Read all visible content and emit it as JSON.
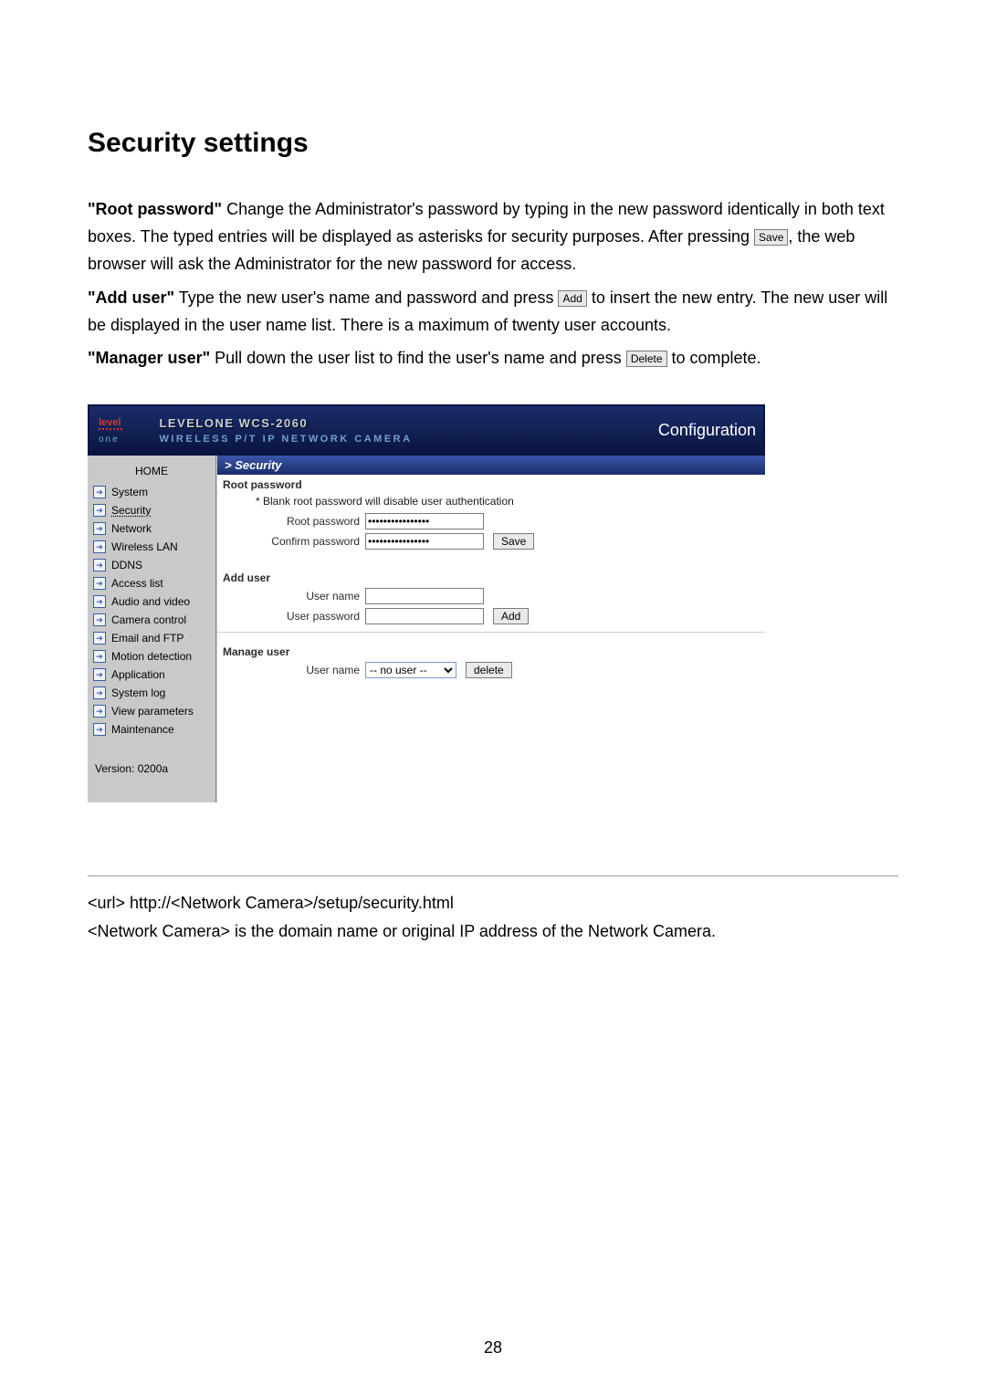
{
  "doc": {
    "title": "Security settings",
    "para1_a": "\"Root password\"",
    "para1_b": " Change the Administrator's password by typing in the new password identically in both text boxes. The typed entries will be displayed as asterisks for security purposes. After pressing ",
    "para1_c": ", the web browser will ask the Administrator for the new password for access.",
    "para2_a": "\"Add user\"",
    "para2_b": " Type the new user's name and password and press ",
    "para2_c": " to insert the new entry. The new user will be displayed in the user name list. There is a maximum of twenty user accounts.",
    "para3_a": "\"Manager user\"",
    "para3_b": " Pull down the user list to find the user's name and press ",
    "para3_c": " to complete.",
    "inline_save": "Save",
    "inline_add": "Add",
    "inline_delete": "Delete",
    "after_line1": "<url> http://<Network Camera>/setup/security.html",
    "after_line2": "<Network Camera> is the domain name or original IP address of the Network Camera.",
    "page_num": "28"
  },
  "shot": {
    "logo_top": "level",
    "logo_bottom": "one",
    "header_line1": "LEVELONE WCS-2060",
    "header_line2": "WIRELESS P/T IP NETWORK CAMERA",
    "header_right": "Configuration",
    "sidebar_home": "HOME",
    "sidebar_items": [
      "System",
      "Security",
      "Network",
      "Wireless LAN",
      "DDNS",
      "Access list",
      "Audio and video",
      "Camera control",
      "Email and FTP",
      "Motion detection",
      "Application",
      "System log",
      "View parameters",
      "Maintenance"
    ],
    "sidebar_version": "Version: 0200a",
    "sec_head": "> Security",
    "root_title": "Root password",
    "root_warn": "* Blank root password will disable user authentication",
    "lbl_root_pw": "Root password",
    "lbl_confirm_pw": "Confirm password",
    "val_root_pw": "••••••••••••••••",
    "val_confirm_pw": "••••••••••••••••",
    "btn_save": "Save",
    "add_title": "Add user",
    "lbl_user_name": "User name",
    "lbl_user_pw": "User password",
    "btn_add": "Add",
    "manage_title": "Manage user",
    "lbl_manage_user": "User name",
    "sel_no_user": "-- no user --",
    "btn_delete": "delete"
  }
}
